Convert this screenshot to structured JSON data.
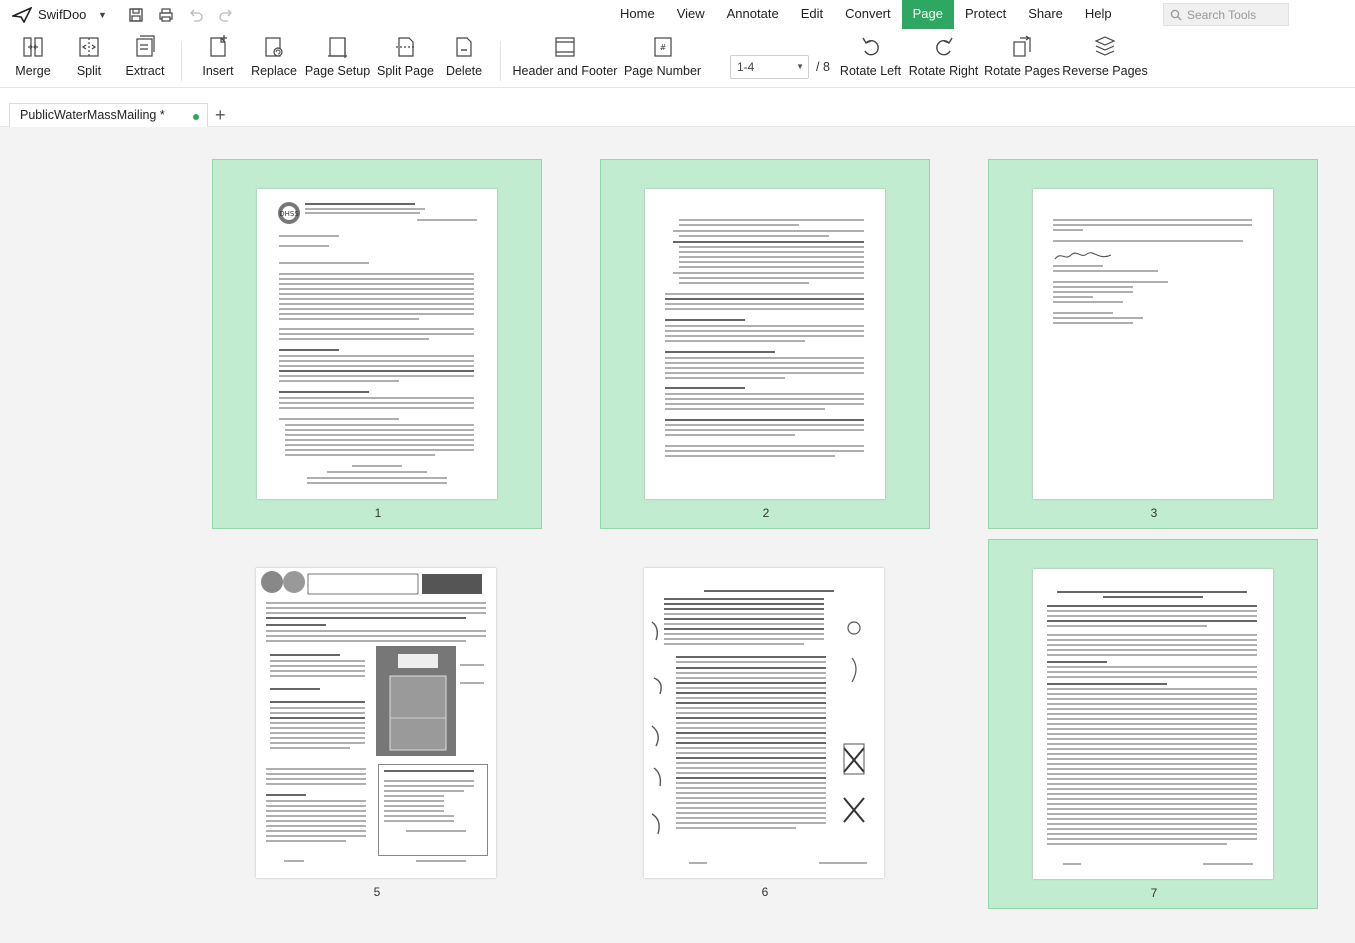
{
  "app": {
    "name": "SwifDoo"
  },
  "menu": [
    "Home",
    "View",
    "Annotate",
    "Edit",
    "Convert",
    "Page",
    "Protect",
    "Share",
    "Help"
  ],
  "active_menu": "Page",
  "search": {
    "placeholder": "Search Tools"
  },
  "toolbar": {
    "merge": "Merge",
    "split": "Split",
    "extract": "Extract",
    "insert": "Insert",
    "replace": "Replace",
    "page_setup": "Page Setup",
    "split_page": "Split Page",
    "delete": "Delete",
    "header_footer": "Header and Footer",
    "page_number": "Page Number",
    "page_range": "1-4",
    "page_total": "/ 8",
    "rotate_left": "Rotate Left",
    "rotate_right": "Rotate Right",
    "rotate_pages": "Rotate Pages",
    "reverse_pages": "Reverse Pages"
  },
  "tab": {
    "title": "PublicWaterMassMailing *"
  },
  "pages": [
    {
      "number": "1",
      "selected": true
    },
    {
      "number": "2",
      "selected": true
    },
    {
      "number": "3",
      "selected": true
    },
    {
      "number": "5",
      "selected": false
    },
    {
      "number": "6",
      "selected": false
    },
    {
      "number": "7",
      "selected": true
    }
  ],
  "colors": {
    "accent": "#2ea760",
    "selection": "#c2ecd0"
  }
}
